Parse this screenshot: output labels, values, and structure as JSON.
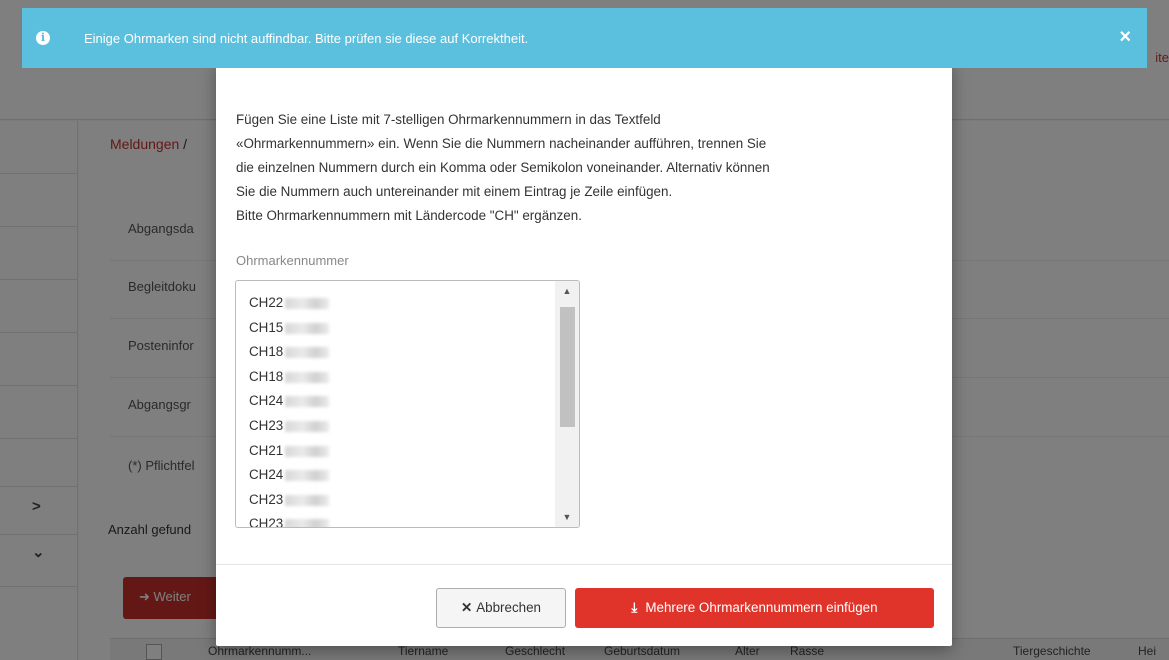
{
  "alert": {
    "icon": "info-circle-icon",
    "text": "Einige Ohrmarken sind nicht auffindbar. Bitte prüfen sie diese auf Korrektheit.",
    "close": "×",
    "color": "#5bc0de"
  },
  "background": {
    "breadcrumb": {
      "first": "Meldungen",
      "separator": "/"
    },
    "labels": [
      "Abgangsda",
      "Begleitdoku",
      "Posteninfor",
      "Abgangsgr",
      "(*) Pflichtfel"
    ],
    "count_label": "Anzahl gefund",
    "weiter_button": "Weiter",
    "table_headers": [
      "Ohrmarkennumm...",
      "Tiername",
      "Geschlecht",
      "Geburtsdatum",
      "Alter",
      "Rasse",
      "Tiergeschichte",
      "Hei"
    ],
    "sidebar_chevrons": [
      ">",
      "⌄"
    ]
  },
  "modal": {
    "intro_lines": [
      "Fügen Sie eine Liste mit 7-stelligen Ohrmarkennummern in das Textfeld",
      "«Ohrmarkennummern» ein. Wenn Sie die Nummern nacheinander aufführen, trennen Sie",
      "die einzelnen Nummern durch ein Komma oder Semikolon voneinander. Alternativ können",
      "Sie die Nummern auch untereinander mit einem Eintrag je Zeile einfügen.",
      "Bitte Ohrmarkennummern mit Ländercode \"CH\" ergänzen."
    ],
    "field_label": "Ohrmarkennummer",
    "textarea_lines": [
      "CH22",
      "CH15",
      "CH18",
      "CH18",
      "CH24",
      "CH23",
      "CH21",
      "CH24",
      "CH23",
      "CH23"
    ],
    "cancel_button": "Abbrechen",
    "insert_button": "Mehrere Ohrmarkennummern einfügen",
    "primary_color": "#e0342b"
  }
}
